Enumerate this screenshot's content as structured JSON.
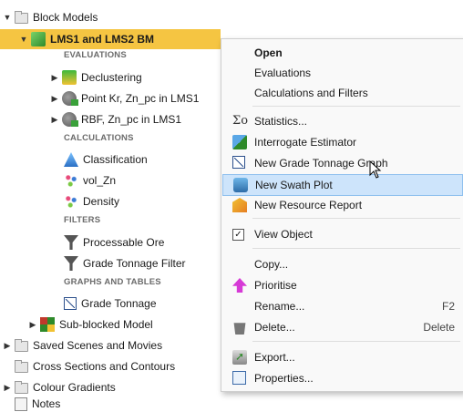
{
  "tree": {
    "items": [
      {
        "id": "block-models",
        "label": "Block Models",
        "section": false
      },
      {
        "id": "lms-bm",
        "label": "LMS1 and LMS2 BM",
        "section": false
      },
      {
        "id": "sec-evaluations",
        "label": "EVALUATIONS",
        "section": true
      },
      {
        "id": "declustering",
        "label": "Declustering",
        "section": false
      },
      {
        "id": "point-kr",
        "label": "Point Kr, Zn_pc in LMS1",
        "section": false
      },
      {
        "id": "rbf",
        "label": "RBF, Zn_pc in LMS1",
        "section": false
      },
      {
        "id": "sec-calculations",
        "label": "CALCULATIONS",
        "section": true
      },
      {
        "id": "classification",
        "label": "Classification",
        "section": false
      },
      {
        "id": "vol-zn",
        "label": "vol_Zn",
        "section": false
      },
      {
        "id": "density",
        "label": "Density",
        "section": false
      },
      {
        "id": "sec-filters",
        "label": "FILTERS",
        "section": true
      },
      {
        "id": "processable-ore",
        "label": "Processable Ore",
        "section": false
      },
      {
        "id": "grade-tonnage-filter",
        "label": "Grade Tonnage Filter",
        "section": false
      },
      {
        "id": "sec-graphs",
        "label": "GRAPHS AND TABLES",
        "section": true
      },
      {
        "id": "grade-tonnage",
        "label": "Grade Tonnage",
        "section": false
      },
      {
        "id": "sub-blocked",
        "label": "Sub-blocked Model",
        "section": false
      },
      {
        "id": "saved-scenes",
        "label": "Saved Scenes and Movies",
        "section": false
      },
      {
        "id": "cross-sections",
        "label": "Cross Sections and Contours",
        "section": false
      },
      {
        "id": "colour-gradients",
        "label": "Colour Gradients",
        "section": false
      },
      {
        "id": "notes",
        "label": "Notes",
        "section": false
      }
    ]
  },
  "menu": {
    "open": "Open",
    "evaluations": "Evaluations",
    "calculations": "Calculations and Filters",
    "statistics": "Statistics...",
    "interrogate": "Interrogate Estimator",
    "new_grade_tonnage": "New Grade Tonnage Graph",
    "new_swath": "New Swath Plot",
    "new_resource": "New Resource Report",
    "view_object": "View Object",
    "copy": "Copy...",
    "prioritise": "Prioritise",
    "rename": "Rename...",
    "rename_shortcut": "F2",
    "delete": "Delete...",
    "delete_shortcut": "Delete",
    "export": "Export...",
    "properties": "Properties...",
    "statistics_icon_glyph": "Σo",
    "view_object_checked": "✓"
  },
  "colors": {
    "selection": "#f5c542",
    "hover": "#cde4fb"
  }
}
